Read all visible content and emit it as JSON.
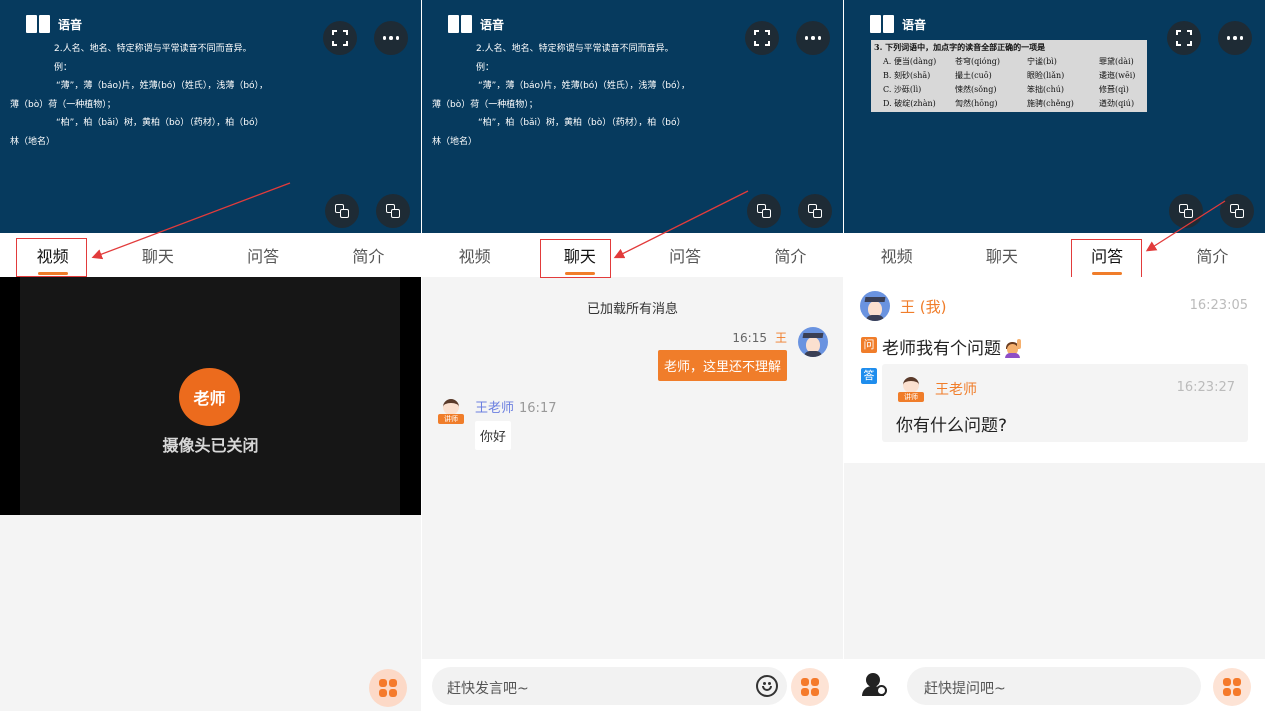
{
  "colors": {
    "slide_bg": "#063a5e",
    "accent": "#f07d2a",
    "highlight_box": "#e23b3b",
    "answer_badge": "#1f8ded",
    "teacher_name_chat": "#6b7fe0"
  },
  "slide": {
    "title": "语音",
    "lines": [
      "2.人名、地名、特定称谓与平常读音不同而音异。",
      "例：",
      "“薄”，薄（báo)片，姓薄(bó)（姓氏），浅薄（bó），",
      "薄（bò）荷（一种植物）；",
      "“柏”，柏（bǎi）树，黄柏（bò）（药材），柏（bó）",
      "林（地名）"
    ],
    "icons": {
      "fullscreen": "fullscreen-icon",
      "more": "more-icon",
      "copy": "copy-icon",
      "share": "screen-share-icon"
    }
  },
  "quiz": {
    "title": "3. 下列词语中，加点字的读音全部正确的一项是",
    "rows": [
      [
        "A. 便当(dàng)",
        "苍穹(qióng)",
        "宁谧(bì)",
        "罪黛(dài)"
      ],
      [
        "B. 刻砂(shā)",
        "撮土(cuō)",
        "眼睑(liǎn)",
        "逶迤(wēi)"
      ],
      [
        "C. 沙砾(lì)",
        "悚然(sǒng)",
        "笨拙(chú)",
        "修葺(qì)"
      ],
      [
        "D. 破绽(zhàn)",
        "訇然(hōng)",
        "施骋(chěng)",
        "遒劲(qiú)"
      ]
    ]
  },
  "tabs": [
    "视频",
    "聊天",
    "问答",
    "简介"
  ],
  "video_panel": {
    "avatar_label": "老师",
    "camera_status": "摄像头已关闭"
  },
  "chat": {
    "loaded_notice": "已加载所有消息",
    "my_time": "16:15",
    "my_name": "王",
    "my_message": "老师，这里还不理解",
    "teacher_name": "王老师",
    "teacher_time": "16:17",
    "teacher_badge": "讲师",
    "teacher_message": "你好",
    "input_placeholder": "赶快发言吧~"
  },
  "qa": {
    "asker_name": "王 (我)",
    "ask_time": "16:23:05",
    "question_badge": "问",
    "question": "老师我有个问题",
    "answer_badge": "答",
    "answerer_name": "王老师",
    "answerer_badge": "讲师",
    "answer_time": "16:23:27",
    "answer": "你有什么问题?",
    "input_placeholder": "赶快提问吧~"
  }
}
